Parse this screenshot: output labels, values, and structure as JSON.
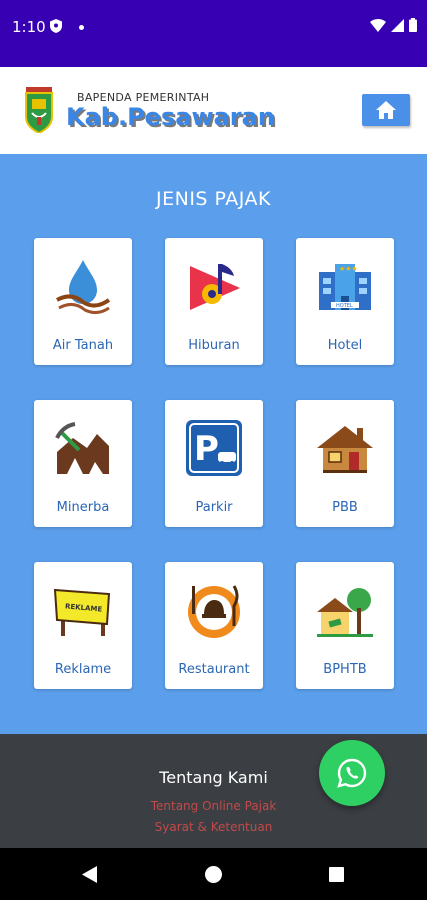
{
  "status": {
    "time": "1:10",
    "icons": [
      "shield-icon",
      "dot-icon",
      "wifi-icon",
      "signal-icon",
      "battery-icon"
    ]
  },
  "header": {
    "subtitle": "BAPENDA PEMERINTAH",
    "title": "Kab.Pesawaran",
    "home_icon": "home-icon"
  },
  "main": {
    "title": "JENIS PAJAK",
    "items": [
      {
        "label": "Air Tanah",
        "icon": "water-drop-icon"
      },
      {
        "label": "Hiburan",
        "icon": "music-play-icon"
      },
      {
        "label": "Hotel",
        "icon": "hotel-icon"
      },
      {
        "label": "Minerba",
        "icon": "mining-icon"
      },
      {
        "label": "Parkir",
        "icon": "parking-icon"
      },
      {
        "label": "PBB",
        "icon": "house-icon"
      },
      {
        "label": "Reklame",
        "icon": "billboard-icon"
      },
      {
        "label": "Restaurant",
        "icon": "restaurant-icon"
      },
      {
        "label": "BPHTB",
        "icon": "property-tree-icon"
      }
    ]
  },
  "footer": {
    "title": "Tentang Kami",
    "links": [
      "Tentang Online Pajak",
      "Syarat & Ketentuan"
    ]
  },
  "fab": {
    "icon": "whatsapp-icon"
  },
  "colors": {
    "status_bar": "#3800b3",
    "main_bg": "#5b9eeb",
    "header_title": "#3a86e6",
    "footer_bg": "#3b3e42",
    "footer_link": "#c24a4a",
    "whatsapp": "#2ecf63"
  }
}
